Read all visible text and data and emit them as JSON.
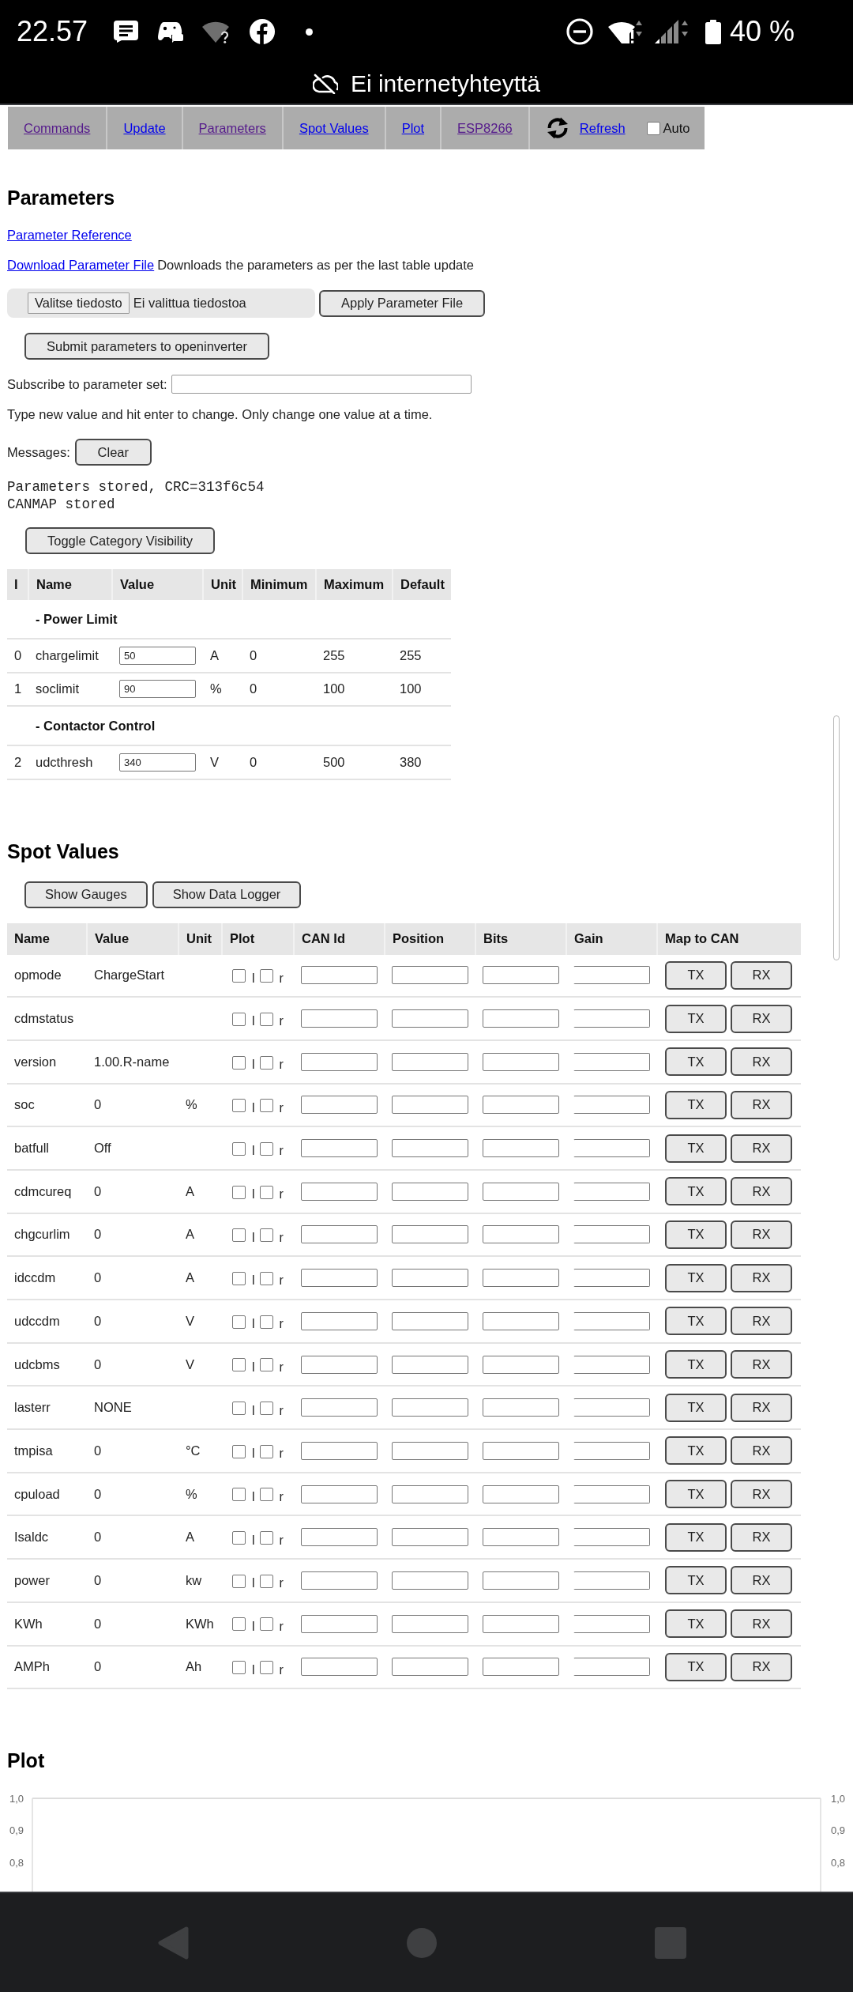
{
  "status_bar": {
    "time": "22.57",
    "battery_text": "40 %"
  },
  "connection_banner": {
    "text": "Ei internetyhteyttä"
  },
  "nav": {
    "links": [
      {
        "label": "Commands",
        "visited": true
      },
      {
        "label": "Update",
        "visited": false
      },
      {
        "label": "Parameters",
        "visited": true
      },
      {
        "label": "Spot Values",
        "visited": false
      },
      {
        "label": "Plot",
        "visited": false
      },
      {
        "label": "ESP8266",
        "visited": true
      }
    ],
    "refresh": {
      "label": "Refresh",
      "visited": false
    },
    "auto": {
      "label": "Auto",
      "checked": false
    }
  },
  "parameters": {
    "title": "Parameters",
    "reference_link": "Parameter Reference",
    "download_link": "Download Parameter File",
    "download_note": "Downloads the parameters as per the last table update",
    "file_input": {
      "button": "Valitse tiedosto",
      "status": "Ei valittua tiedostoa"
    },
    "apply_button": "Apply Parameter File",
    "submit_button": "Submit parameters to openinverter",
    "subscribe_label": "Subscribe to parameter set:",
    "hint": "Type new value and hit enter to change. Only change one value at a time.",
    "messages_label": "Messages:",
    "clear_button": "Clear",
    "messages": [
      "Parameters stored, CRC=313f6c54",
      "CANMAP stored"
    ],
    "toggle_button": "Toggle Category Visibility",
    "table": {
      "columns": [
        "I",
        "Name",
        "Value",
        "Unit",
        "Minimum",
        "Maximum",
        "Default"
      ],
      "rows": [
        {
          "kind": "category",
          "label": "- Power Limit"
        },
        {
          "kind": "parameter",
          "index": "0",
          "name": "chargelimit",
          "value": "50",
          "unit": "A",
          "minimum": "0",
          "maximum": "255",
          "default": "255"
        },
        {
          "kind": "parameter",
          "index": "1",
          "name": "soclimit",
          "value": "90",
          "unit": "%",
          "minimum": "0",
          "maximum": "100",
          "default": "100"
        },
        {
          "kind": "category",
          "label": "- Contactor Control"
        },
        {
          "kind": "parameter",
          "index": "2",
          "name": "udcthresh",
          "value": "340",
          "unit": "V",
          "minimum": "0",
          "maximum": "500",
          "default": "380"
        }
      ]
    }
  },
  "spot_values": {
    "title": "Spot Values",
    "buttons": [
      "Show Gauges",
      "Show Data Logger"
    ],
    "columns": [
      "Name",
      "Value",
      "Unit",
      "Plot",
      "CAN Id",
      "Position",
      "Bits",
      "Gain",
      "Map to CAN"
    ],
    "rows": [
      {
        "name": "opmode",
        "value": "ChargeStart",
        "plot": [
          {
            "label": "l",
            "checked": false
          },
          {
            "label": "r",
            "checked": false
          }
        ],
        "map_buttons": [
          "TX",
          "RX"
        ]
      },
      {
        "name": "cdmstatus",
        "plot": [
          {
            "label": "l",
            "checked": false
          },
          {
            "label": "r",
            "checked": false
          }
        ],
        "map_buttons": [
          "TX",
          "RX"
        ]
      },
      {
        "name": "version",
        "value": "1.00.R-name",
        "plot": [
          {
            "label": "l",
            "checked": false
          },
          {
            "label": "r",
            "checked": false
          }
        ],
        "map_buttons": [
          "TX",
          "RX"
        ]
      },
      {
        "name": "soc",
        "value": "0",
        "unit": "%",
        "plot": [
          {
            "label": "l",
            "checked": false
          },
          {
            "label": "r",
            "checked": false
          }
        ],
        "map_buttons": [
          "TX",
          "RX"
        ]
      },
      {
        "name": "batfull",
        "value": "Off",
        "plot": [
          {
            "label": "l",
            "checked": false
          },
          {
            "label": "r",
            "checked": false
          }
        ],
        "map_buttons": [
          "TX",
          "RX"
        ]
      },
      {
        "name": "cdmcureq",
        "value": "0",
        "unit": "A",
        "plot": [
          {
            "label": "l",
            "checked": false
          },
          {
            "label": "r",
            "checked": false
          }
        ],
        "map_buttons": [
          "TX",
          "RX"
        ]
      },
      {
        "name": "chgcurlim",
        "value": "0",
        "unit": "A",
        "plot": [
          {
            "label": "l",
            "checked": false
          },
          {
            "label": "r",
            "checked": false
          }
        ],
        "map_buttons": [
          "TX",
          "RX"
        ]
      },
      {
        "name": "idccdm",
        "value": "0",
        "unit": "A",
        "plot": [
          {
            "label": "l",
            "checked": false
          },
          {
            "label": "r",
            "checked": false
          }
        ],
        "map_buttons": [
          "TX",
          "RX"
        ]
      },
      {
        "name": "udccdm",
        "value": "0",
        "unit": "V",
        "plot": [
          {
            "label": "l",
            "checked": false
          },
          {
            "label": "r",
            "checked": false
          }
        ],
        "map_buttons": [
          "TX",
          "RX"
        ]
      },
      {
        "name": "udcbms",
        "value": "0",
        "unit": "V",
        "plot": [
          {
            "label": "l",
            "checked": false
          },
          {
            "label": "r",
            "checked": false
          }
        ],
        "map_buttons": [
          "TX",
          "RX"
        ]
      },
      {
        "name": "lasterr",
        "value": "NONE",
        "plot": [
          {
            "label": "l",
            "checked": false
          },
          {
            "label": "r",
            "checked": false
          }
        ],
        "map_buttons": [
          "TX",
          "RX"
        ]
      },
      {
        "name": "tmpisa",
        "value": "0",
        "unit": "°C",
        "plot": [
          {
            "label": "l",
            "checked": false
          },
          {
            "label": "r",
            "checked": false
          }
        ],
        "map_buttons": [
          "TX",
          "RX"
        ]
      },
      {
        "name": "cpuload",
        "value": "0",
        "unit": "%",
        "plot": [
          {
            "label": "l",
            "checked": false
          },
          {
            "label": "r",
            "checked": false
          }
        ],
        "map_buttons": [
          "TX",
          "RX"
        ]
      },
      {
        "name": "Isaldc",
        "value": "0",
        "unit": "A",
        "plot": [
          {
            "label": "l",
            "checked": false
          },
          {
            "label": "r",
            "checked": false
          }
        ],
        "map_buttons": [
          "TX",
          "RX"
        ]
      },
      {
        "name": "power",
        "value": "0",
        "unit": "kw",
        "plot": [
          {
            "label": "l",
            "checked": false
          },
          {
            "label": "r",
            "checked": false
          }
        ],
        "map_buttons": [
          "TX",
          "RX"
        ]
      },
      {
        "name": "KWh",
        "value": "0",
        "unit": "KWh",
        "plot": [
          {
            "label": "l",
            "checked": false
          },
          {
            "label": "r",
            "checked": false
          }
        ],
        "map_buttons": [
          "TX",
          "RX"
        ]
      },
      {
        "name": "AMPh",
        "value": "0",
        "unit": "Ah",
        "plot": [
          {
            "label": "l",
            "checked": false
          },
          {
            "label": "r",
            "checked": false
          }
        ],
        "map_buttons": [
          "TX",
          "RX"
        ]
      }
    ]
  },
  "plot": {
    "title": "Plot",
    "left_ticks": [
      "1,0",
      "0,9",
      "0,8"
    ],
    "right_ticks": [
      "1,0",
      "0,9",
      "0,8"
    ]
  }
}
